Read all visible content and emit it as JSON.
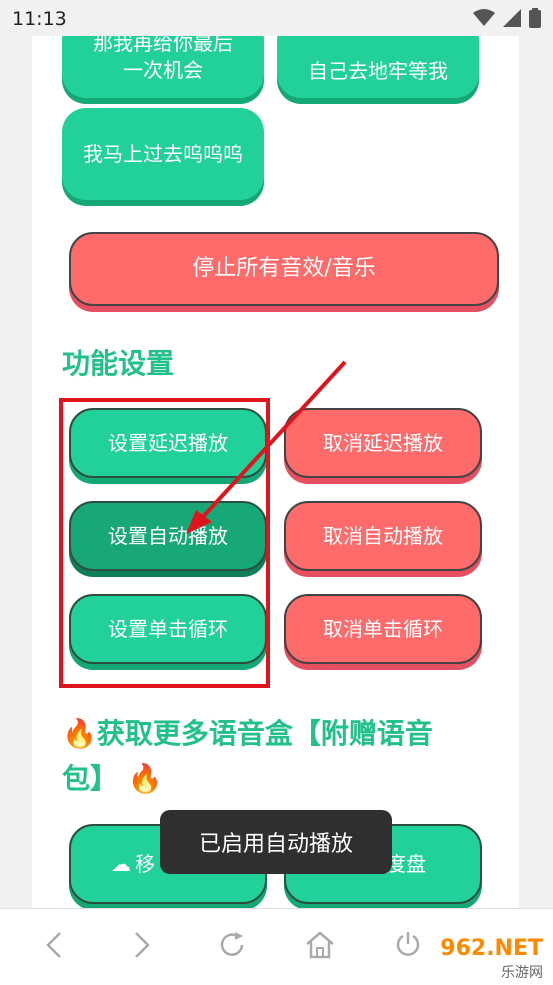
{
  "status": {
    "time": "11:13"
  },
  "sound_buttons": {
    "partial_left": "那我再给你最后一次机会",
    "partial_right": "自己去地牢等我",
    "item": "我马上过去呜呜呜"
  },
  "stop_all_label": "停止所有音效/音乐",
  "settings": {
    "title": "功能设置",
    "set_delay": "设置延迟播放",
    "cancel_delay": "取消延迟播放",
    "set_auto": "设置自动播放",
    "cancel_auto": "取消自动播放",
    "set_loop": "设置单击循环",
    "cancel_loop": "取消单击循环"
  },
  "more": {
    "title_line1": "获取更多语音盒【附赠语音",
    "title_line2": "包】",
    "btn_left": "移",
    "btn_right": "度盘"
  },
  "toast": "已启用自动播放",
  "watermark": {
    "brand": "962.NET",
    "subtext": "乐游网"
  },
  "colors": {
    "green": "#22d19a",
    "red": "#ff6b6b",
    "title": "#22c08a"
  }
}
